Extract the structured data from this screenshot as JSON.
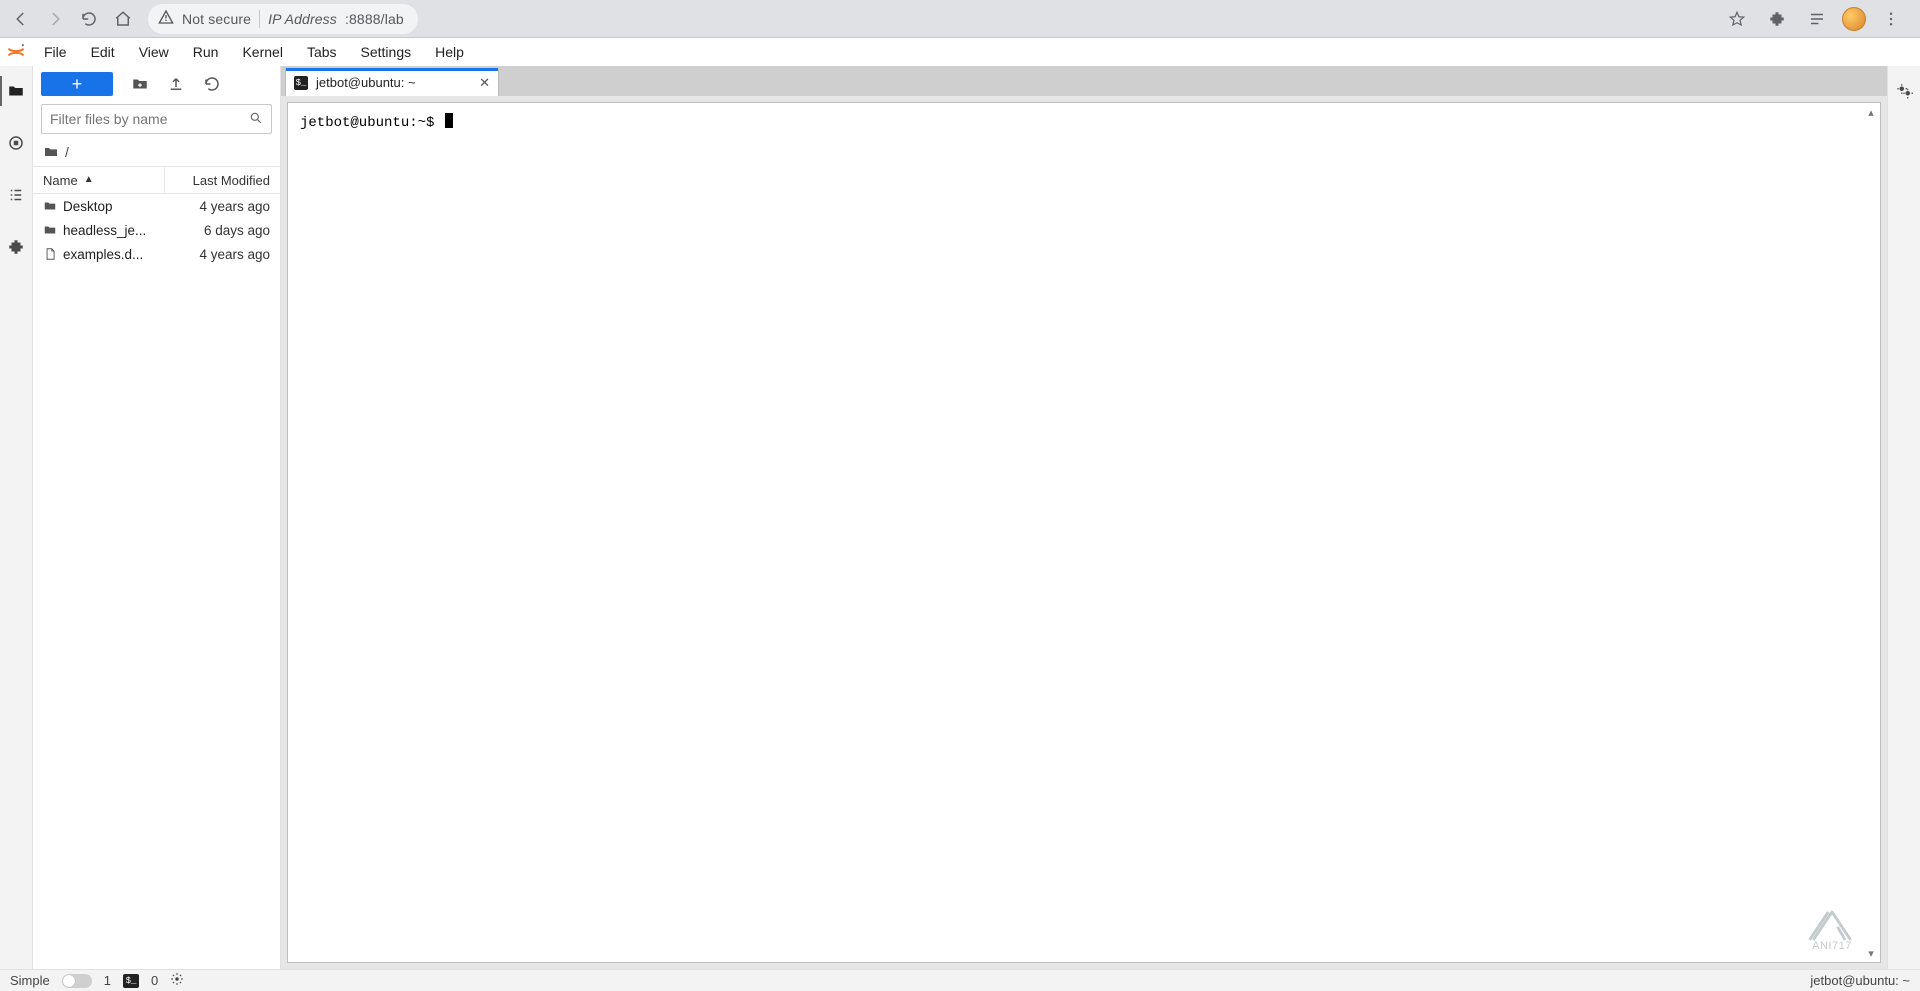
{
  "browser": {
    "not_secure_label": "Not secure",
    "url_prefix": "IP Address",
    "url_suffix": ":8888/lab"
  },
  "menus": [
    "File",
    "Edit",
    "View",
    "Run",
    "Kernel",
    "Tabs",
    "Settings",
    "Help"
  ],
  "filebrowser": {
    "filter_placeholder": "Filter files by name",
    "breadcrumb": "/",
    "header_name": "Name",
    "header_modified": "Last Modified",
    "items": [
      {
        "icon": "folder",
        "name": "Desktop",
        "modified": "4 years ago"
      },
      {
        "icon": "folder",
        "name": "headless_je...",
        "modified": "6 days ago"
      },
      {
        "icon": "file",
        "name": "examples.d...",
        "modified": "4 years ago"
      }
    ]
  },
  "tab": {
    "title": "jetbot@ubuntu: ~"
  },
  "terminal": {
    "prompt": "jetbot@ubuntu:~$ "
  },
  "statusbar": {
    "mode_label": "Simple",
    "term_count": "1",
    "kernel_count": "0",
    "doc_label": "jetbot@ubuntu: ~"
  },
  "watermark": "ANI717"
}
